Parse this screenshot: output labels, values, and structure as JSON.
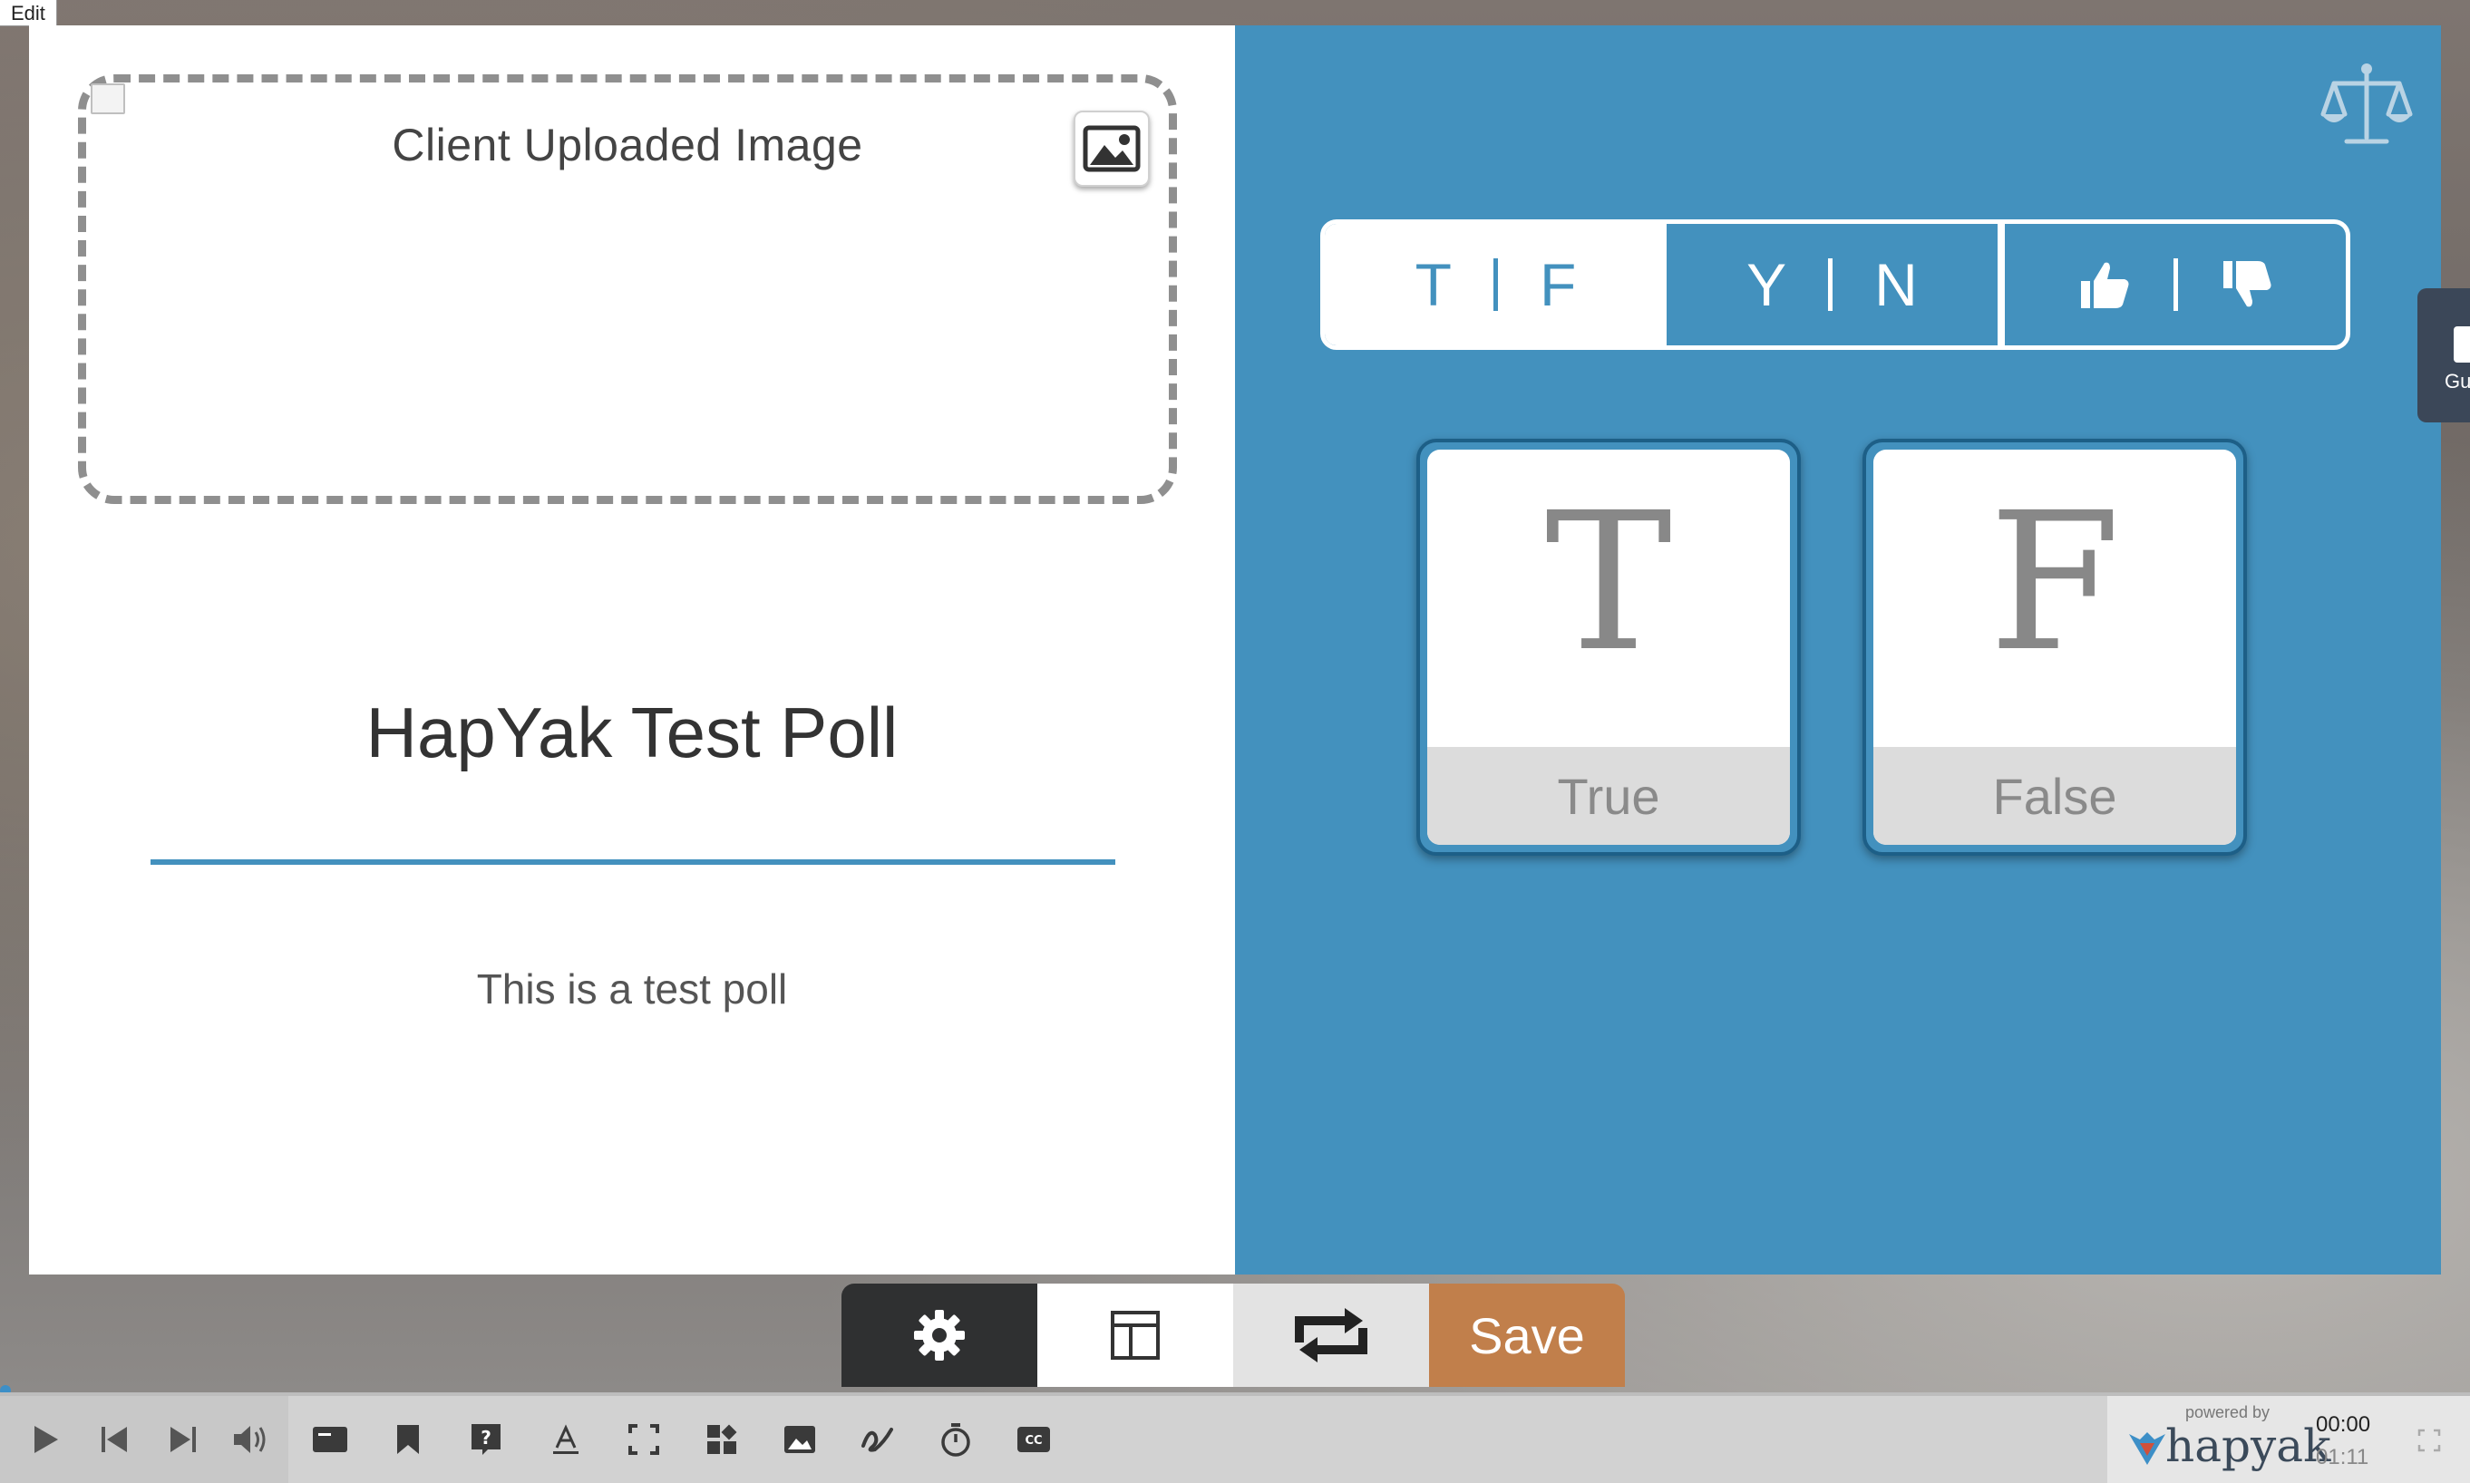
{
  "edit_tab": "Edit",
  "left_panel": {
    "image_caption": "Client Uploaded Image",
    "poll_title": "HapYak Test Poll",
    "poll_description": "This is a test poll"
  },
  "right_panel": {
    "answer_types": [
      {
        "left": "T",
        "right": "F",
        "selected": true
      },
      {
        "left": "Y",
        "right": "N",
        "selected": false
      },
      {
        "left": "thumbs-up-icon",
        "right": "thumbs-down-icon",
        "selected": false
      }
    ],
    "cards": [
      {
        "letter": "T",
        "label": "True"
      },
      {
        "letter": "F",
        "label": "False"
      }
    ]
  },
  "guide_tab": {
    "label": "Gu"
  },
  "edit_toolbar": {
    "save_label": "Save"
  },
  "player": {
    "powered_by": "powered by",
    "brand": "hapyak",
    "current_time": "00:00",
    "duration": "01:11"
  },
  "colors": {
    "accent_blue": "#4391be",
    "save": "#c17f4b",
    "dark": "#2f3031"
  }
}
